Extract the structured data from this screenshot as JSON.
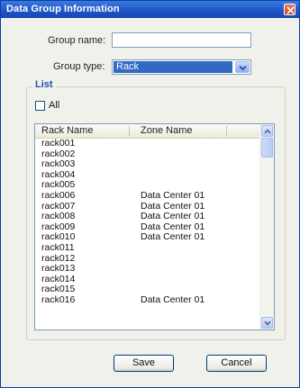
{
  "window": {
    "title": "Data Group Information"
  },
  "form": {
    "group_name_label": "Group name:",
    "group_name_value": "",
    "group_type_label": "Group type:",
    "group_type_value": "Rack"
  },
  "list": {
    "legend": "List",
    "all_label": "All",
    "all_checked": false,
    "columns": [
      "Rack Name",
      "Zone Name"
    ],
    "rows": [
      [
        "rack001",
        ""
      ],
      [
        "rack002",
        ""
      ],
      [
        "rack003",
        ""
      ],
      [
        "rack004",
        ""
      ],
      [
        "rack005",
        ""
      ],
      [
        "rack006",
        "Data Center 01"
      ],
      [
        "rack007",
        "Data Center 01"
      ],
      [
        "rack008",
        "Data Center 01"
      ],
      [
        "rack009",
        "Data Center 01"
      ],
      [
        "rack010",
        "Data Center 01"
      ],
      [
        "rack011",
        ""
      ],
      [
        "rack012",
        ""
      ],
      [
        "rack013",
        ""
      ],
      [
        "rack014",
        ""
      ],
      [
        "rack015",
        ""
      ],
      [
        "rack016",
        "Data Center 01"
      ]
    ]
  },
  "buttons": {
    "save": "Save",
    "cancel": "Cancel"
  },
  "colors": {
    "titlebar": "#1f56c8",
    "accent": "#316ac5",
    "legend": "#2050b0"
  },
  "icons": {
    "close": "close-icon",
    "dropdown": "chevron-down-icon",
    "scroll_up": "arrow-up-icon",
    "scroll_down": "arrow-down-icon"
  }
}
